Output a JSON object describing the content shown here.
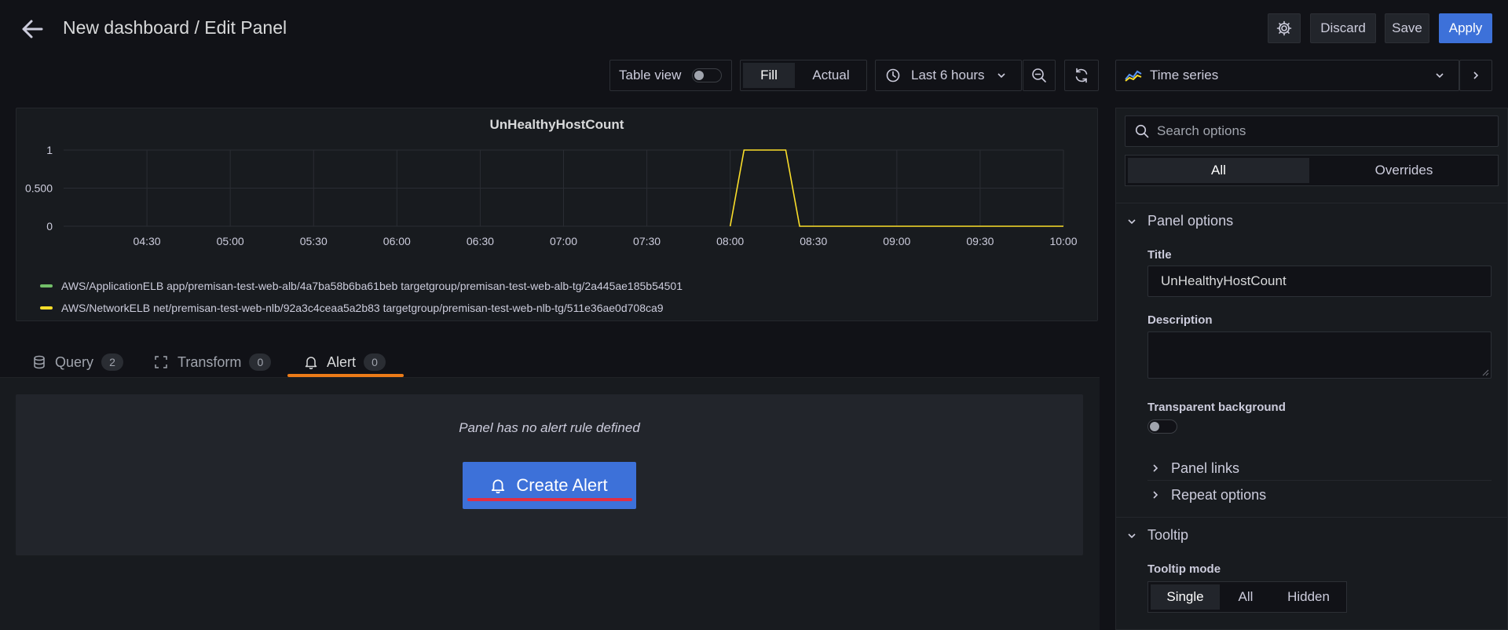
{
  "header": {
    "breadcrumb": "New dashboard / Edit Panel",
    "discard_label": "Discard",
    "save_label": "Save",
    "apply_label": "Apply"
  },
  "toolbar": {
    "table_view_label": "Table view",
    "fill_label": "Fill",
    "actual_label": "Actual",
    "time_range": "Last 6 hours",
    "visualization": "Time series"
  },
  "chart_data": {
    "type": "line",
    "title": "UnHealthyHostCount",
    "x": [
      "04:30",
      "05:00",
      "05:30",
      "06:00",
      "06:30",
      "07:00",
      "07:30",
      "08:00",
      "08:30",
      "09:00",
      "09:30",
      "10:00"
    ],
    "y_ticks": [
      "1",
      "0.500",
      "0"
    ],
    "ylim": [
      0,
      1
    ],
    "grid": true,
    "legend_placement": "bottom-left",
    "series": [
      {
        "name": "AWS/ApplicationELB app/premisan-test-web-alb/4a7ba58b6ba61beb targetgroup/premisan-test-web-alb-tg/2a445ae185b54501",
        "color": "#73bf69",
        "points": []
      },
      {
        "name": "AWS/NetworkELB net/premisan-test-web-nlb/92a3c4ceaa5a2b83 targetgroup/premisan-test-web-nlb-tg/511e36ae0d708ca9",
        "color": "#fade2a",
        "points": [
          [
            "08:00",
            0
          ],
          [
            "08:05",
            1
          ],
          [
            "08:20",
            1
          ],
          [
            "08:25",
            0
          ],
          [
            "10:00",
            0
          ]
        ]
      }
    ]
  },
  "tabs": [
    {
      "label": "Query",
      "count": "2",
      "icon": "database-icon"
    },
    {
      "label": "Transform",
      "count": "0",
      "icon": "transform-icon"
    },
    {
      "label": "Alert",
      "count": "0",
      "icon": "bell-icon"
    }
  ],
  "alert": {
    "message": "Panel has no alert rule defined",
    "create_label": "Create Alert"
  },
  "options": {
    "search_placeholder": "Search options",
    "filter_all": "All",
    "filter_overrides": "Overrides",
    "panel_options_title": "Panel options",
    "title_label": "Title",
    "title_value": "UnHealthyHostCount",
    "description_label": "Description",
    "description_value": "",
    "transparent_label": "Transparent background",
    "panel_links": "Panel links",
    "repeat_options": "Repeat options",
    "tooltip_title": "Tooltip",
    "tooltip_mode_label": "Tooltip mode",
    "tooltip_modes": [
      "Single",
      "All",
      "Hidden"
    ],
    "tooltip_selected": "Single"
  },
  "colors": {
    "accent": "#3d71d9",
    "alert_tab_underline": "#eb7b18",
    "annotation_underline": "#e02f44"
  }
}
